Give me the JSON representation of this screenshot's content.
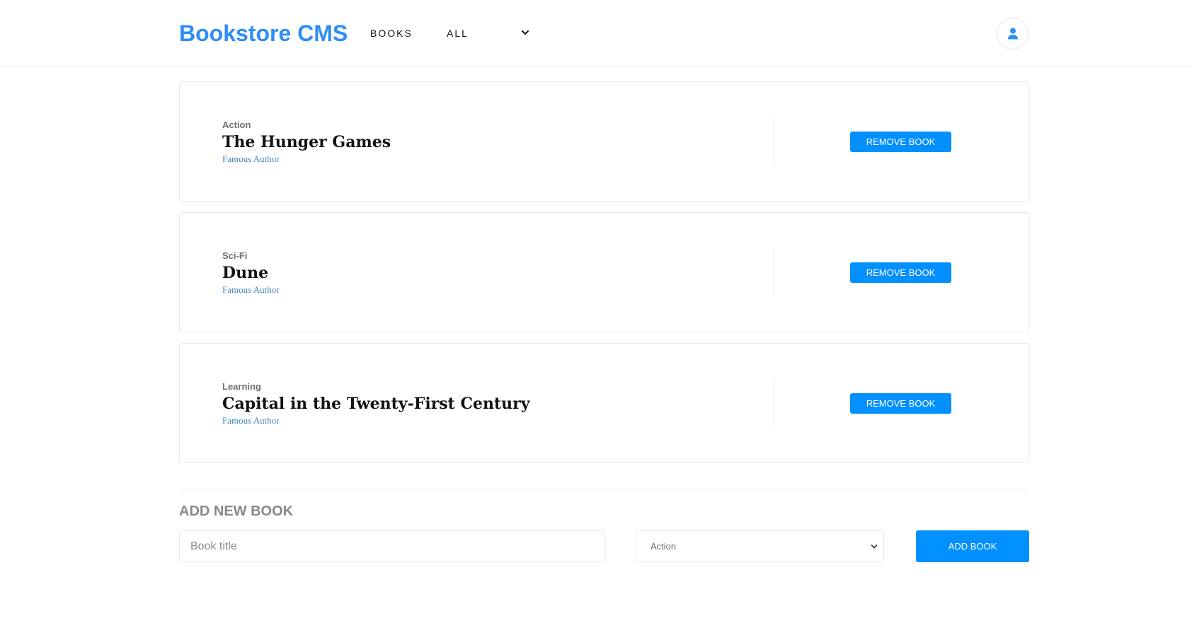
{
  "header": {
    "brand": "Bookstore CMS",
    "nav_books": "BOOKS",
    "nav_filter": "ALL",
    "user_icon": "user-icon"
  },
  "books": [
    {
      "genre": "Action",
      "title": "The Hunger Games",
      "author": "Famous Author",
      "remove_label": "REMOVE BOOK"
    },
    {
      "genre": "Sci-Fi",
      "title": "Dune",
      "author": "Famous Author",
      "remove_label": "REMOVE BOOK"
    },
    {
      "genre": "Learning",
      "title": "Capital in the Twenty-First Century",
      "author": "Famous Author",
      "remove_label": "REMOVE BOOK"
    }
  ],
  "add_book": {
    "heading": "ADD NEW BOOK",
    "title_placeholder": "Book title",
    "category_selected": "Action",
    "submit_label": "ADD BOOK"
  },
  "colors": {
    "brand": "#2e8ef5",
    "button": "#0290ff",
    "author_link": "#4386bf",
    "border": "#e8e8e8"
  }
}
